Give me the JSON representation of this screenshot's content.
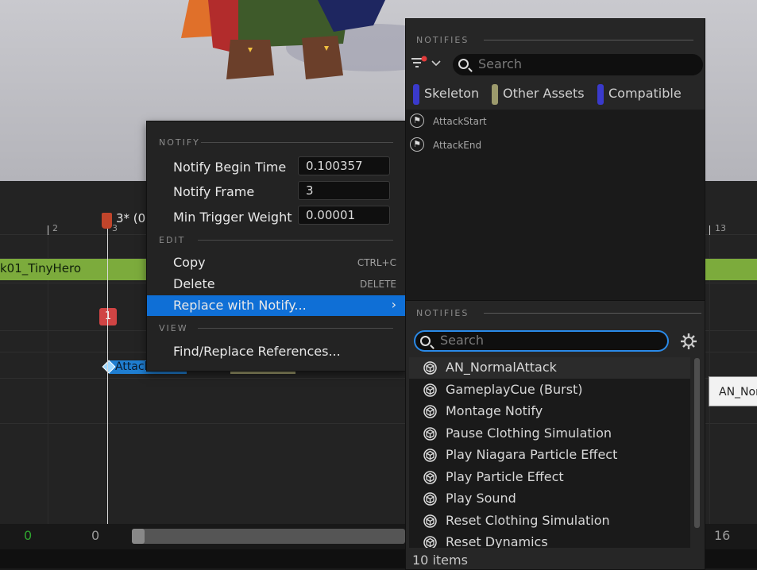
{
  "colors": {
    "accent_selected": "#0f6fd6",
    "anim_bar": "#7cab3c",
    "skeleton_swatch": "#3a3acc",
    "other_assets_swatch": "#9c9a6c",
    "compatible_swatch": "#3a3acc",
    "notify_chip": "#1f7ed1",
    "playhead": "#c0452b"
  },
  "timeline": {
    "ticks": [
      "2",
      "3",
      "13"
    ],
    "frame_label": "3* (0",
    "anim_bar_label": "k01_TinyHero",
    "track_badge": "1",
    "notify_chip_label": "AttackStart",
    "right_ghost_label": "AN_NormalAttack",
    "bottom_left_green": "0",
    "bottom_left": "0",
    "bottom_right": "16"
  },
  "context_menu": {
    "notify_header": "NOTIFY",
    "props": [
      {
        "label": "Notify Begin Time",
        "value": "0.100357"
      },
      {
        "label": "Notify Frame",
        "value": "3"
      },
      {
        "label": "Min Trigger Weight",
        "value": "0.00001"
      }
    ],
    "edit_header": "EDIT",
    "items": [
      {
        "label": "Copy",
        "shortcut": "CTRL+C"
      },
      {
        "label": "Delete",
        "shortcut": "DELETE"
      },
      {
        "label": "Replace with Notify...",
        "shortcut": ""
      }
    ],
    "view_header": "VIEW",
    "view_items": [
      {
        "label": "Find/Replace References..."
      }
    ]
  },
  "top_panel": {
    "header": "NOTIFIES",
    "search_placeholder": "Search",
    "filters": [
      {
        "label": "Skeleton",
        "color": "#3a3acc"
      },
      {
        "label": "Other Assets",
        "color": "#9c9a6c"
      },
      {
        "label": "Compatible",
        "color": "#3a3acc"
      }
    ],
    "skeleton_notifies": [
      "AttackStart",
      "AttackEnd"
    ]
  },
  "bottom_panel": {
    "header": "NOTIFIES",
    "search_placeholder": "Search",
    "items": [
      "AN_NormalAttack",
      "GameplayCue (Burst)",
      "Montage Notify",
      "Pause Clothing Simulation",
      "Play Niagara Particle Effect",
      "Play Particle Effect",
      "Play Sound",
      "Reset Clothing Simulation",
      "Reset Dynamics"
    ],
    "items_count": "10 items"
  }
}
